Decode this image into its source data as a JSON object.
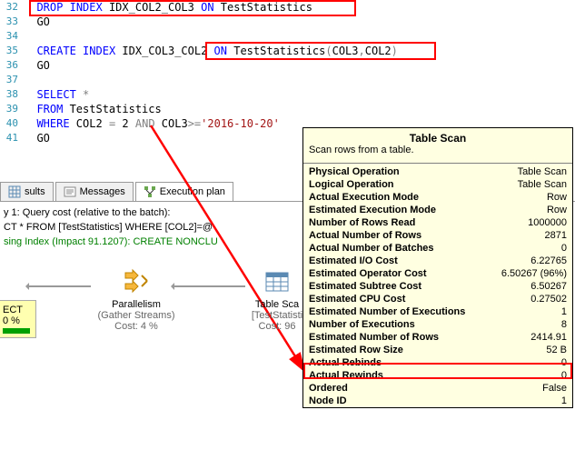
{
  "editor": {
    "lines": [
      {
        "n": "32",
        "tokens": [
          {
            "c": "kw",
            "t": "DROP"
          },
          {
            "c": "txt",
            "t": " "
          },
          {
            "c": "kw",
            "t": "INDEX"
          },
          {
            "c": "txt",
            "t": " IDX_COL2_COL3 "
          },
          {
            "c": "kw",
            "t": "ON"
          },
          {
            "c": "txt",
            "t": " TestStatistics"
          }
        ]
      },
      {
        "n": "33",
        "tokens": [
          {
            "c": "txt",
            "t": "GO"
          }
        ]
      },
      {
        "n": "34",
        "tokens": []
      },
      {
        "n": "35",
        "tokens": [
          {
            "c": "kw",
            "t": "CREATE"
          },
          {
            "c": "txt",
            "t": " "
          },
          {
            "c": "kw",
            "t": "INDEX"
          },
          {
            "c": "txt",
            "t": " IDX_COL3_COL2 "
          },
          {
            "c": "kw",
            "t": "ON"
          },
          {
            "c": "txt",
            "t": " TestStatistics"
          },
          {
            "c": "op",
            "t": "("
          },
          {
            "c": "txt",
            "t": "COL3"
          },
          {
            "c": "op",
            "t": ","
          },
          {
            "c": "txt",
            "t": "COL2"
          },
          {
            "c": "op",
            "t": ")"
          }
        ]
      },
      {
        "n": "36",
        "tokens": [
          {
            "c": "txt",
            "t": "GO"
          }
        ]
      },
      {
        "n": "37",
        "tokens": []
      },
      {
        "n": "38",
        "tokens": [
          {
            "c": "kw",
            "t": "SELECT"
          },
          {
            "c": "txt",
            "t": " "
          },
          {
            "c": "op",
            "t": "*"
          }
        ]
      },
      {
        "n": "39",
        "tokens": [
          {
            "c": "kw",
            "t": "FROM"
          },
          {
            "c": "txt",
            "t": " TestStatistics"
          }
        ]
      },
      {
        "n": "40",
        "tokens": [
          {
            "c": "kw",
            "t": "WHERE"
          },
          {
            "c": "txt",
            "t": " COL2 "
          },
          {
            "c": "op",
            "t": "="
          },
          {
            "c": "txt",
            "t": " "
          },
          {
            "c": "num",
            "t": "2"
          },
          {
            "c": "txt",
            "t": " "
          },
          {
            "c": "op",
            "t": "AND"
          },
          {
            "c": "txt",
            "t": " COL3"
          },
          {
            "c": "op",
            "t": ">="
          },
          {
            "c": "str",
            "t": "'2016-10-20'"
          }
        ]
      },
      {
        "n": "41",
        "tokens": [
          {
            "c": "txt",
            "t": "GO"
          }
        ]
      }
    ]
  },
  "tabs": {
    "results": "sults",
    "messages": "Messages",
    "plan": "Execution plan"
  },
  "plan": {
    "line1": "y 1: Query cost (relative to the batch):",
    "line2": "CT * FROM [TestStatistics] WHERE [COL2]=@",
    "line3": "sing Index (Impact 91.1207): CREATE NONCLU",
    "select": {
      "label": "ECT",
      "pct": "0 %"
    },
    "parallelism": {
      "title": "Parallelism",
      "sub": "(Gather Streams)",
      "cost": "Cost: 4 %"
    },
    "tablescan": {
      "title": "Table Sca",
      "sub": "[TestStatisti",
      "cost": "Cost: 96"
    }
  },
  "tooltip": {
    "title": "Table Scan",
    "desc": "Scan rows from a table.",
    "rows": [
      {
        "k": "Physical Operation",
        "v": "Table Scan"
      },
      {
        "k": "Logical Operation",
        "v": "Table Scan"
      },
      {
        "k": "Actual Execution Mode",
        "v": "Row"
      },
      {
        "k": "Estimated Execution Mode",
        "v": "Row"
      },
      {
        "k": "Number of Rows Read",
        "v": "1000000"
      },
      {
        "k": "Actual Number of Rows",
        "v": "2871"
      },
      {
        "k": "Actual Number of Batches",
        "v": "0"
      },
      {
        "k": "Estimated I/O Cost",
        "v": "6.22765"
      },
      {
        "k": "Estimated Operator Cost",
        "v": "6.50267 (96%)"
      },
      {
        "k": "Estimated Subtree Cost",
        "v": "6.50267"
      },
      {
        "k": "Estimated CPU Cost",
        "v": "0.27502"
      },
      {
        "k": "Estimated Number of Executions",
        "v": "1"
      },
      {
        "k": "Number of Executions",
        "v": "8"
      },
      {
        "k": "Estimated Number of Rows",
        "v": "2414.91"
      },
      {
        "k": "Estimated Row Size",
        "v": "52 B"
      },
      {
        "k": "Actual Rebinds",
        "v": "0"
      },
      {
        "k": "Actual Rewinds",
        "v": "0"
      },
      {
        "k": "Ordered",
        "v": "False"
      },
      {
        "k": "Node ID",
        "v": "1"
      }
    ]
  }
}
